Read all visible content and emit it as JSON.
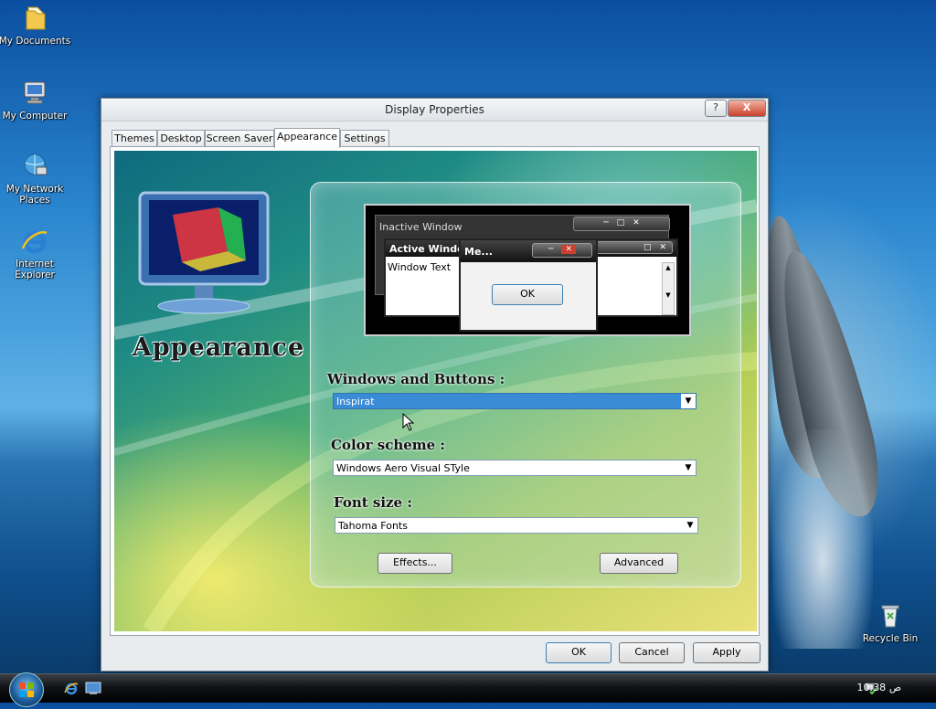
{
  "desktop": {
    "icons": [
      {
        "label": "My Documents"
      },
      {
        "label": "My Computer"
      },
      {
        "label_line1": "My Network",
        "label_line2": "Places"
      },
      {
        "label_line1": "Internet",
        "label_line2": "Explorer"
      },
      {
        "label": "Recycle Bin"
      }
    ]
  },
  "window": {
    "title": "Display Properties",
    "help_glyph": "?",
    "close_glyph": "X",
    "tabs": [
      {
        "label": "Themes"
      },
      {
        "label": "Desktop"
      },
      {
        "label": "Screen Saver"
      },
      {
        "label": "Appearance",
        "active": true
      },
      {
        "label": "Settings"
      }
    ],
    "logo_text": "Appearance",
    "preview": {
      "inactive_title": "Inactive Window",
      "active_title": "Active Window",
      "window_text": "Window Text",
      "message_title": "Me...",
      "ok_label": "OK"
    },
    "windows_buttons_label": "Windows and Buttons :",
    "windows_buttons_value": "Inspirat",
    "color_scheme_label": "Color scheme :",
    "color_scheme_value": "Windows Aero Visual STyle",
    "font_size_label": "Font size :",
    "font_size_value": "Tahoma Fonts",
    "effects_label": "Effects...",
    "advanced_label": "Advanced",
    "ok_label": "OK",
    "cancel_label": "Cancel",
    "apply_label": "Apply"
  },
  "taskbar": {
    "time": "10:38",
    "ampm": "ص"
  },
  "colors": {
    "selection": "#3a8bd6",
    "close_button": "#c9402d"
  }
}
